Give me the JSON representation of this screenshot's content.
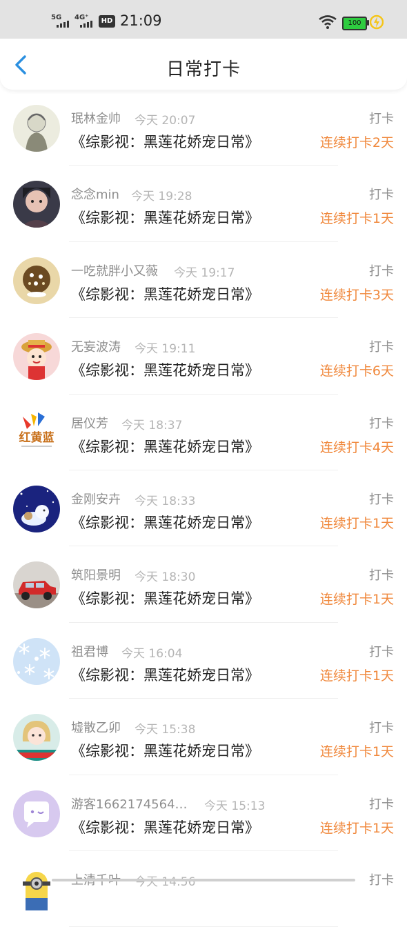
{
  "status_bar": {
    "network1": "5G",
    "network2": "4G⁺",
    "hd": "HD",
    "time": "21:09",
    "battery": "100",
    "battery_color": "#2ecc40"
  },
  "header": {
    "title": "日常打卡",
    "back_icon": "chevron-left-icon",
    "accent_color": "#2a8fe0"
  },
  "colors": {
    "streak": "#f0883c",
    "name": "#8e8e8e",
    "time": "#b5b5b5"
  },
  "checkins": [
    {
      "name": "珉林金帅",
      "time": "今天 20:07",
      "type": "打卡",
      "book": "《综影视：黑莲花娇宠日常》",
      "streak": "连续打卡2天",
      "avatar": "sketch-avatar"
    },
    {
      "name": "念念min",
      "time": "今天 19:28",
      "type": "打卡",
      "book": "《综影视：黑莲花娇宠日常》",
      "streak": "连续打卡1天",
      "avatar": "photo-avatar"
    },
    {
      "name": "一吃就胖小又薇",
      "time": "今天 19:17",
      "type": "打卡",
      "book": "《综影视：黑莲花娇宠日常》",
      "streak": "连续打卡3天",
      "avatar": "cookie-avatar"
    },
    {
      "name": "无妄波涛",
      "time": "今天 19:11",
      "type": "打卡",
      "book": "《综影视：黑莲花娇宠日常》",
      "streak": "连续打卡6天",
      "avatar": "cartoon-avatar"
    },
    {
      "name": "居仪芳",
      "time": "今天 18:37",
      "type": "打卡",
      "book": "《综影视：黑莲花娇宠日常》",
      "streak": "连续打卡4天",
      "avatar": "logo-avatar",
      "avatar_text": "红黄蓝"
    },
    {
      "name": "金刚安卉",
      "time": "今天 18:33",
      "type": "打卡",
      "book": "《综影视：黑莲花娇宠日常》",
      "streak": "连续打卡1天",
      "avatar": "night-avatar"
    },
    {
      "name": "筑阳景明",
      "time": "今天 18:30",
      "type": "打卡",
      "book": "《综影视：黑莲花娇宠日常》",
      "streak": "连续打卡1天",
      "avatar": "car-avatar"
    },
    {
      "name": "祖君博",
      "time": "今天 16:04",
      "type": "打卡",
      "book": "《综影视：黑莲花娇宠日常》",
      "streak": "连续打卡1天",
      "avatar": "snowflake-avatar"
    },
    {
      "name": "墟散乙卯",
      "time": "今天 15:38",
      "type": "打卡",
      "book": "《综影视：黑莲花娇宠日常》",
      "streak": "连续打卡1天",
      "avatar": "girl-avatar"
    },
    {
      "name": "游客1662174564…",
      "time": "今天 15:13",
      "type": "打卡",
      "book": "《综影视：黑莲花娇宠日常》",
      "streak": "连续打卡1天",
      "avatar": "default-avatar"
    },
    {
      "name": "上清千叶",
      "time": "今天 14:56",
      "type": "打卡",
      "book": "",
      "streak": "",
      "avatar": "minion-avatar"
    }
  ]
}
